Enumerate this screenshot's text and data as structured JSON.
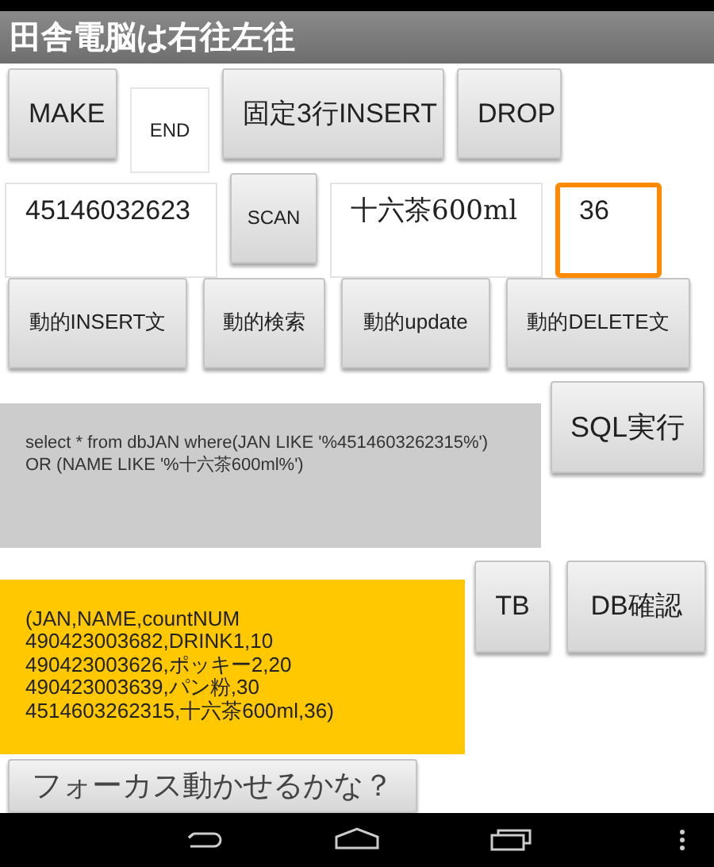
{
  "app_bar": {
    "title": "田舎電脳は右往左往"
  },
  "row_1": [
    {
      "kind": "button",
      "label": "MAKE"
    },
    {
      "kind": "label",
      "label": "END"
    },
    {
      "kind": "button",
      "label": "固定3行INSERT"
    },
    {
      "kind": "button",
      "label": "DROP"
    }
  ],
  "row_2": [
    {
      "kind": "field",
      "value": "45146032623",
      "focused": false
    },
    {
      "kind": "button",
      "label": "SCAN"
    },
    {
      "kind": "field",
      "value": "十六茶600ml",
      "focused": false
    },
    {
      "kind": "field",
      "value": "36",
      "focused": true
    }
  ],
  "row_3": [
    "動的INSERT文",
    "動的検索",
    "動的update",
    "動的DELETE文"
  ],
  "sql": {
    "text": "select * from dbJAN where(JAN LIKE '%4514603262315%') OR (NAME LIKE '%十六茶600ml%')",
    "button": "SQL実行"
  },
  "result": {
    "lines": [
      "(JAN,NAME,countNUM",
      "490423003682,DRINK1,10",
      "490423003626,ポッキー2,20",
      "490423003639,パン粉,30",
      "4514603262315,十六茶600ml,36)"
    ],
    "buttons": [
      "TB",
      "DB確認"
    ]
  },
  "bottom_button": "フォーカス動かせるかな？"
}
